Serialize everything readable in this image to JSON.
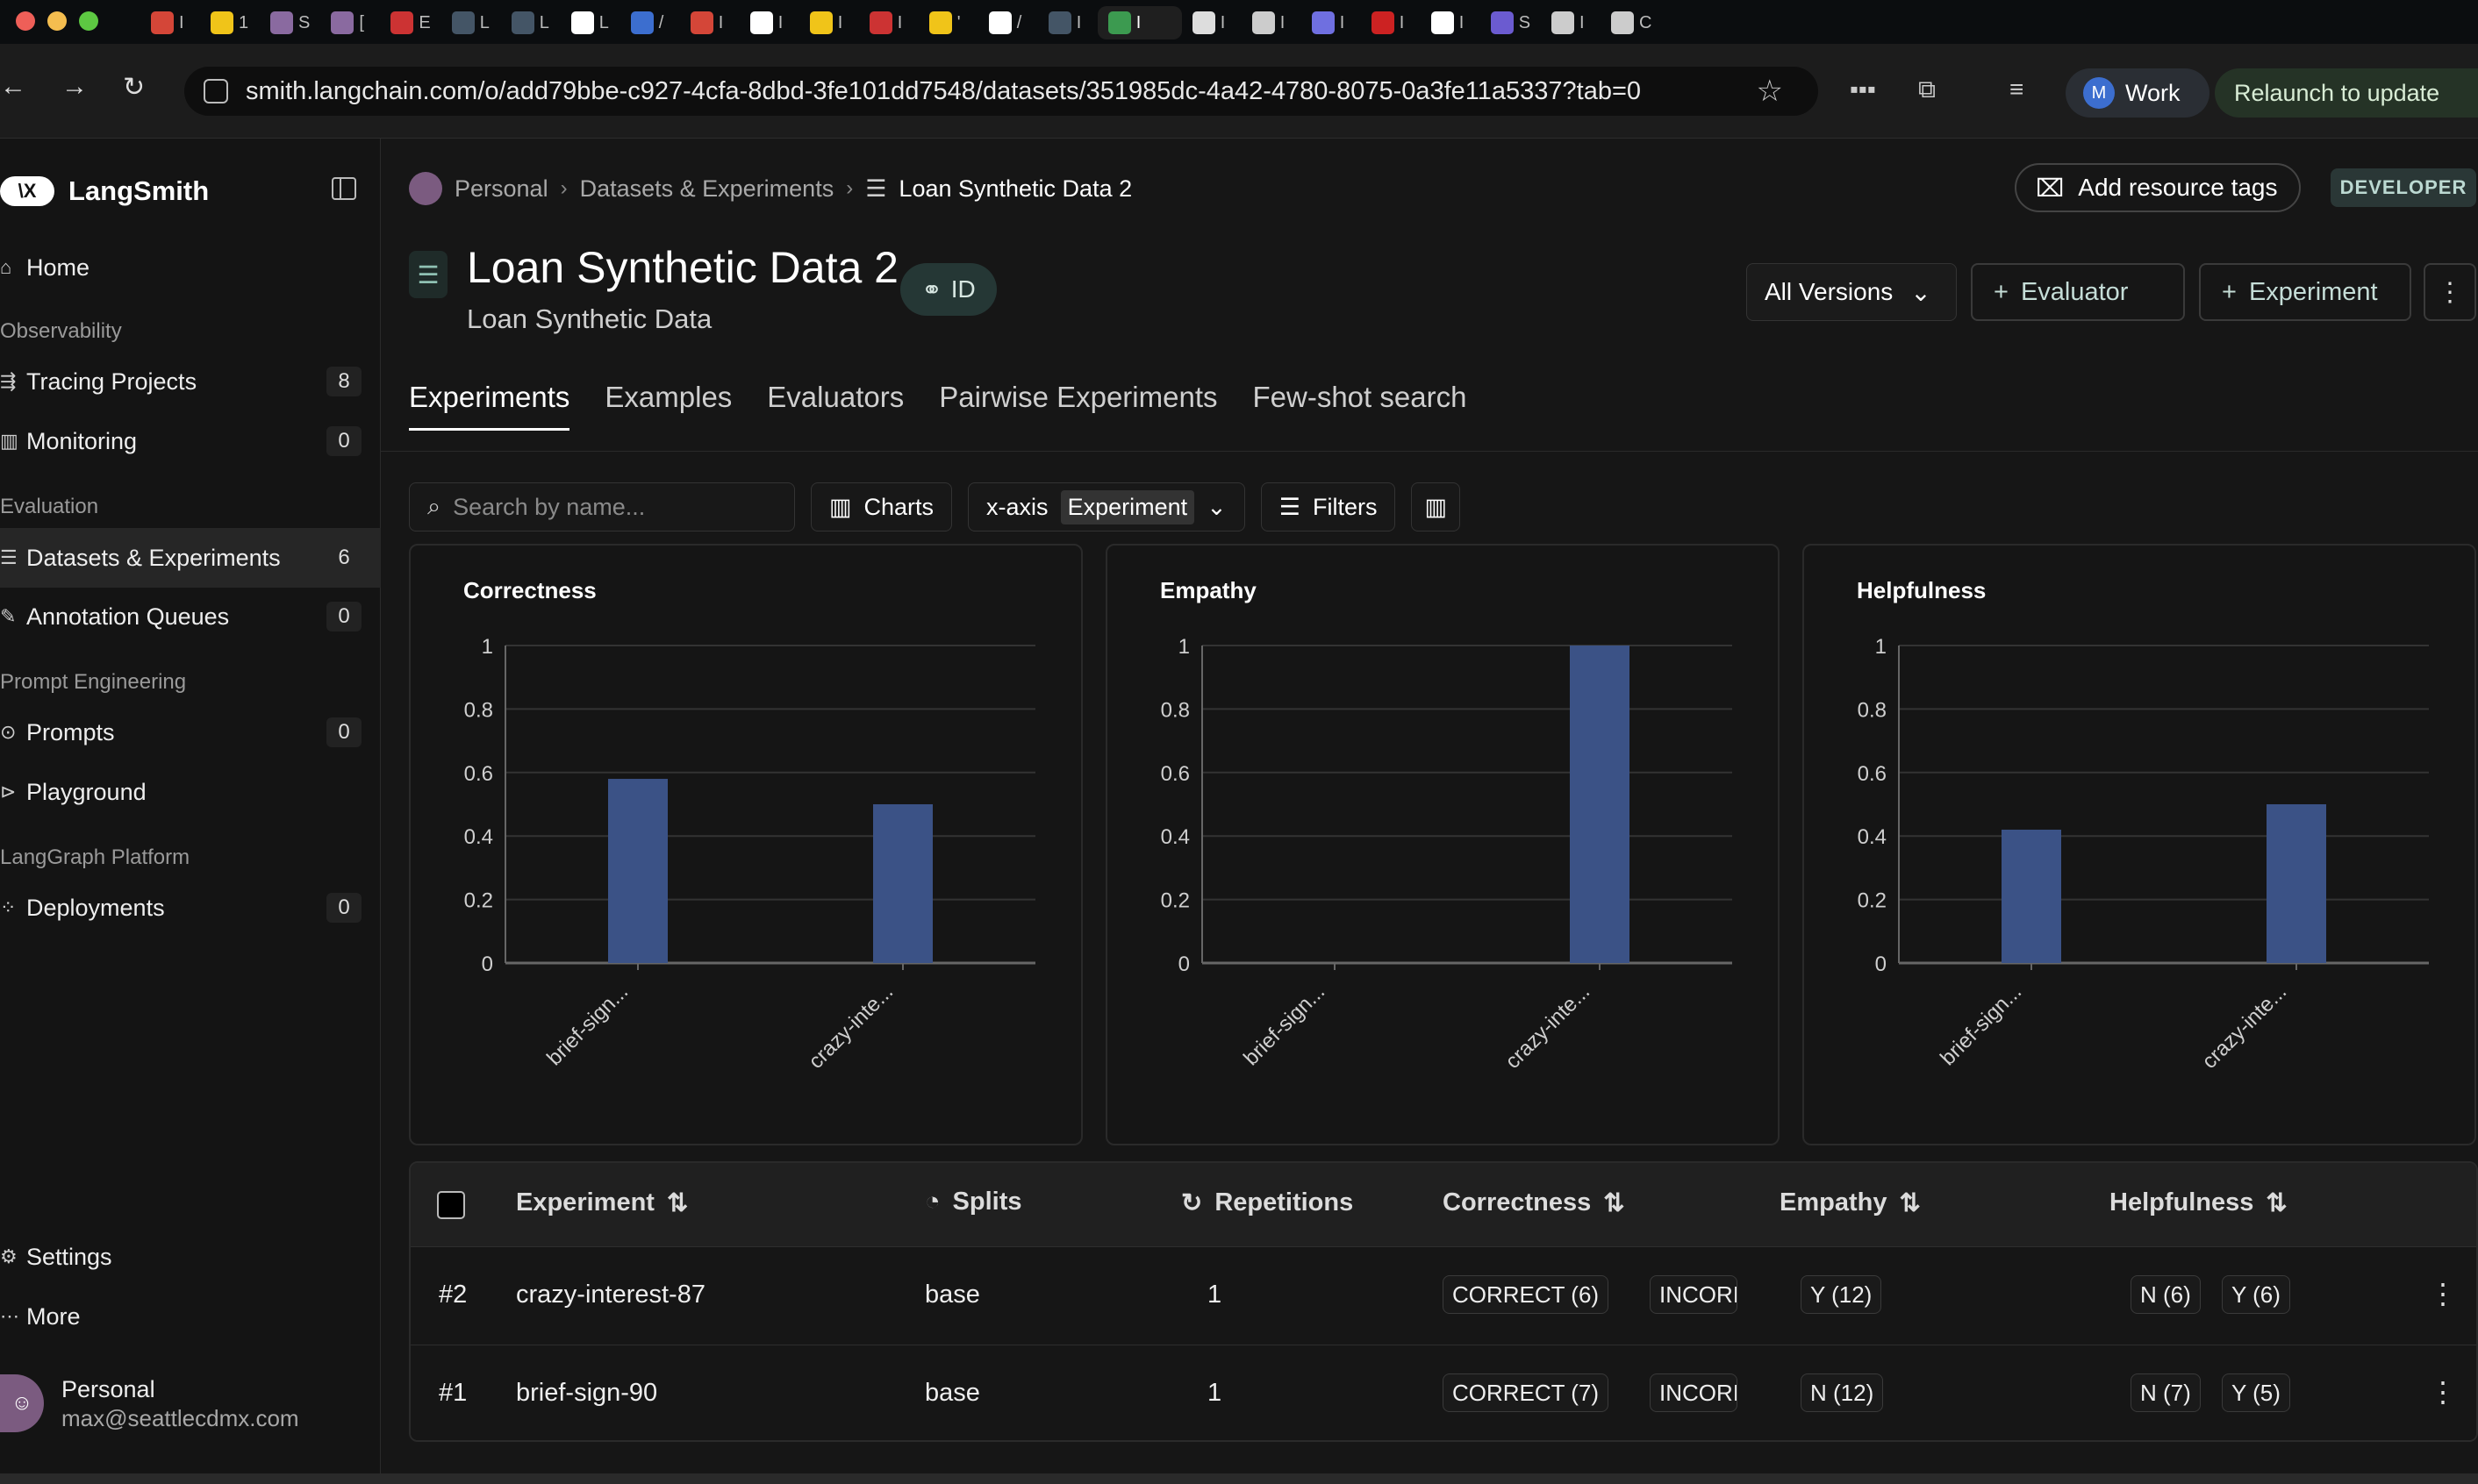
{
  "browser": {
    "tabs": [
      {
        "label": "I",
        "color": "#d44638"
      },
      {
        "label": "1",
        "color": "#f0c419"
      },
      {
        "label": "S",
        "color": "#8a6aa0"
      },
      {
        "label": "[",
        "color": "#8a6aa0"
      },
      {
        "label": "E",
        "color": "#cc3333"
      },
      {
        "label": "L",
        "color": "#445566"
      },
      {
        "label": "L",
        "color": "#445566"
      },
      {
        "label": "L",
        "color": "#ffffff"
      },
      {
        "label": "/",
        "color": "#3c6ecf"
      },
      {
        "label": "I",
        "color": "#d44638"
      },
      {
        "label": "I",
        "color": "#ffffff"
      },
      {
        "label": "I",
        "color": "#f0c419"
      },
      {
        "label": "I",
        "color": "#cc3333"
      },
      {
        "label": "'",
        "color": "#f0c419"
      },
      {
        "label": "/",
        "color": "#ffffff"
      },
      {
        "label": "I",
        "color": "#445566"
      },
      {
        "label": "I",
        "color": "#3c9a50"
      },
      {
        "label": "I",
        "color": "#dddddd"
      },
      {
        "label": "I",
        "color": "#cccccc"
      },
      {
        "label": "I",
        "color": "#6f6fe0"
      },
      {
        "label": "I",
        "color": "#cc2222"
      },
      {
        "label": "I",
        "color": "#ffffff"
      },
      {
        "label": "S",
        "color": "#6b5bd0"
      },
      {
        "label": "I",
        "color": "#cccccc"
      },
      {
        "label": "C",
        "color": "#cccccc"
      }
    ],
    "url": "smith.langchain.com/o/add79bbe-c927-4cfa-8dbd-3fe101dd7548/datasets/351985dc-4a42-4780-8075-0a3fe11a5337?tab=0",
    "profile_initial": "M",
    "profile_label": "Work",
    "relaunch_label": "Relaunch to update"
  },
  "sidebar": {
    "brand": "LangSmith",
    "logo_text": "\\X",
    "home": "Home",
    "sections": {
      "observability": "Observability",
      "evaluation": "Evaluation",
      "prompt_engineering": "Prompt Engineering",
      "langgraph": "LangGraph Platform"
    },
    "items": [
      {
        "label": "Tracing Projects",
        "count": "8"
      },
      {
        "label": "Monitoring",
        "count": "0"
      },
      {
        "label": "Datasets & Experiments",
        "count": "6"
      },
      {
        "label": "Annotation Queues",
        "count": "0"
      },
      {
        "label": "Prompts",
        "count": "0"
      },
      {
        "label": "Playground",
        "count": ""
      },
      {
        "label": "Deployments",
        "count": "0"
      }
    ],
    "settings": "Settings",
    "more": "More",
    "user_name": "Personal",
    "user_email": "max@seattlecdmx.com"
  },
  "header": {
    "breadcrumb": [
      "Personal",
      "Datasets & Experiments",
      "Loan Synthetic Data 2"
    ],
    "add_tags": "Add resource tags",
    "badge": "DEVELOPER",
    "title": "Loan Synthetic Data 2",
    "subtitle": "Loan Synthetic Data",
    "id_label": "ID",
    "versions": "All Versions",
    "evaluator_btn": "Evaluator",
    "experiment_btn": "Experiment"
  },
  "tabs": [
    "Experiments",
    "Examples",
    "Evaluators",
    "Pairwise Experiments",
    "Few-shot search"
  ],
  "toolbar": {
    "search_placeholder": "Search by name...",
    "charts": "Charts",
    "xaxis_label": "x-axis",
    "xaxis_value": "Experiment",
    "filters": "Filters"
  },
  "chart_data": [
    {
      "type": "bar",
      "title": "Correctness",
      "categories": [
        "brief-sign...",
        "crazy-inte..."
      ],
      "values": [
        0.58,
        0.5
      ],
      "ylim": [
        0,
        1
      ],
      "yticks": [
        "0",
        "0.2",
        "0.4",
        "0.6",
        "0.8",
        "1"
      ],
      "grid": true,
      "color": "#3b5286"
    },
    {
      "type": "bar",
      "title": "Empathy",
      "categories": [
        "brief-sign...",
        "crazy-inte..."
      ],
      "values": [
        0,
        1
      ],
      "ylim": [
        0,
        1
      ],
      "yticks": [
        "0",
        "0.2",
        "0.4",
        "0.6",
        "0.8",
        "1"
      ],
      "grid": true,
      "color": "#3b5286"
    },
    {
      "type": "bar",
      "title": "Helpfulness",
      "categories": [
        "brief-sign...",
        "crazy-inte..."
      ],
      "values": [
        0.42,
        0.5
      ],
      "ylim": [
        0,
        1
      ],
      "yticks": [
        "0",
        "0.2",
        "0.4",
        "0.6",
        "0.8",
        "1"
      ],
      "grid": true,
      "color": "#3b5286"
    }
  ],
  "table": {
    "columns": [
      "Experiment",
      "Splits",
      "Repetitions",
      "Correctness",
      "Empathy",
      "Helpfulness"
    ],
    "rows": [
      {
        "num": "#2",
        "experiment": "crazy-interest-87",
        "splits": "base",
        "reps": "1",
        "correctness": [
          "CORRECT (6)",
          "INCORI"
        ],
        "empathy": [
          "Y (12)"
        ],
        "helpfulness": [
          "N (6)",
          "Y (6)"
        ]
      },
      {
        "num": "#1",
        "experiment": "brief-sign-90",
        "splits": "base",
        "reps": "1",
        "correctness": [
          "CORRECT (7)",
          "INCORI"
        ],
        "empathy": [
          "N (12)"
        ],
        "helpfulness": [
          "N (7)",
          "Y (5)"
        ]
      }
    ]
  }
}
